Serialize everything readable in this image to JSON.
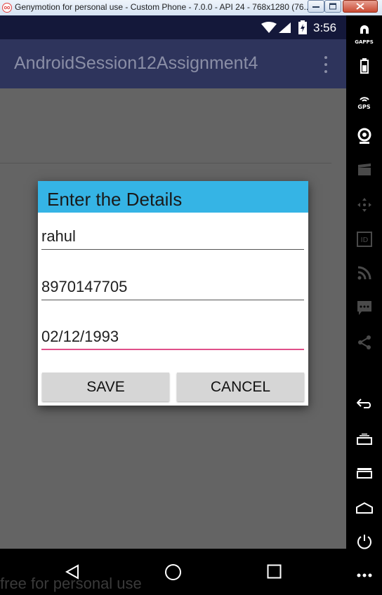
{
  "window": {
    "title": "Genymotion for personal use - Custom Phone - 7.0.0 - API 24 - 768x1280 (76..."
  },
  "status_bar": {
    "time": "3:56"
  },
  "app_bar": {
    "title": "AndroidSession12Assignment4"
  },
  "dialog": {
    "title": "Enter the Details",
    "fields": {
      "name": "rahul",
      "phone": "8970147705",
      "date": "02/12/1993"
    },
    "buttons": {
      "save": "SAVE",
      "cancel": "CANCEL"
    }
  },
  "watermark": "free for personal use",
  "sidebar": {
    "gapps_label": "GAPPS",
    "gps_label": "GPS",
    "icons": [
      "gapps-icon",
      "battery-icon",
      "gps-icon",
      "camera-icon",
      "video-icon",
      "dpad-icon",
      "id-icon",
      "rss-icon",
      "sms-icon",
      "share-icon",
      "back-icon",
      "recent-apps-icon",
      "menu-icon",
      "home-icon",
      "power-icon",
      "more-icon"
    ]
  },
  "colors": {
    "dialog_header": "#35b4e5",
    "focused_underline": "#e0508a",
    "app_bar": "#2e345c",
    "status_bar": "#14183a"
  }
}
